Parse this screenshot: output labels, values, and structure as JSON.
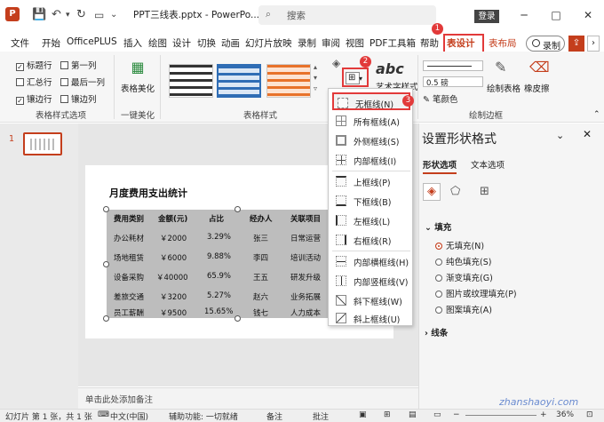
{
  "title_bar": {
    "file_name": "PPT三线表.pptx - PowerPo...",
    "search_placeholder": "搜索",
    "login_label": "登录",
    "minimize": "─",
    "maximize": "□",
    "close": "✕"
  },
  "tabs": [
    "文件",
    "开始",
    "OfficePLUS",
    "插入",
    "绘图",
    "设计",
    "切换",
    "动画",
    "幻灯片放映",
    "录制",
    "审阅",
    "视图",
    "PDF工具箱",
    "帮助",
    "表设计",
    "表布局"
  ],
  "record_label": "录制",
  "badges": [
    "1",
    "2",
    "3"
  ],
  "ribbon": {
    "options": [
      {
        "label": "标题行",
        "checked": true
      },
      {
        "label": "第一列",
        "checked": false
      },
      {
        "label": "汇总行",
        "checked": false
      },
      {
        "label": "最后一列",
        "checked": false
      },
      {
        "label": "镶边行",
        "checked": true
      },
      {
        "label": "镶边列",
        "checked": false
      }
    ],
    "group_table_style_options": "表格样式选项",
    "beautify_label": "表格美化",
    "group_one_click": "一键美化",
    "group_table_styles": "表格样式",
    "art_text_label": "艺术字样式",
    "pen_weight": "0.5 磅",
    "pen_color": "笔颜色",
    "draw_table": "绘制表格",
    "eraser": "橡皮擦",
    "group_draw_borders": "绘制边框"
  },
  "slide_number": "1",
  "slide": {
    "title": "月度费用支出统计",
    "headers": [
      "费用类别",
      "金额(元)",
      "占比",
      "经办人",
      "关联项目"
    ],
    "rows": [
      [
        "办公耗材",
        "￥2000",
        "3.29%",
        "张三",
        "日常运营"
      ],
      [
        "场地租赁",
        "￥6000",
        "9.88%",
        "李四",
        "培训活动"
      ],
      [
        "设备采购",
        "￥40000",
        "65.9%",
        "王五",
        "研发升级"
      ],
      [
        "差旅交通",
        "￥3200",
        "5.27%",
        "赵六",
        "业务拓展"
      ],
      [
        "员工薪酬",
        "￥9500",
        "15.65%",
        "钱七",
        "人力成本"
      ]
    ]
  },
  "notes_placeholder": "单击此处添加备注",
  "border_menu": [
    "无框线(N)",
    "所有框线(A)",
    "外侧框线(S)",
    "内部框线(I)",
    "上框线(P)",
    "下框线(B)",
    "左框线(L)",
    "右框线(R)",
    "内部横框线(H)",
    "内部竖框线(V)",
    "斜下框线(W)",
    "斜上框线(U)"
  ],
  "format_pane": {
    "title": "设置形状格式",
    "tab_shape": "形状选项",
    "tab_text": "文本选项",
    "fill_header": "填充",
    "fill_options": [
      "无填充(N)",
      "纯色填充(S)",
      "渐变填充(G)",
      "图片或纹理填充(P)",
      "图案填充(A)"
    ],
    "fill_selected": 0,
    "line_header": "线条"
  },
  "status": {
    "slide_info": "幻灯片 第 1 张，共 1 张",
    "language": "中文(中国)",
    "accessibility": "辅助功能: 一切就绪",
    "notes": "备注",
    "comments": "批注",
    "zoom": "36%"
  },
  "watermark": "zhanshaoyi.com",
  "colors": {
    "accent": "#c43e1c",
    "highlight": "#e23a3a",
    "table_fill": "#bdbdbd"
  }
}
